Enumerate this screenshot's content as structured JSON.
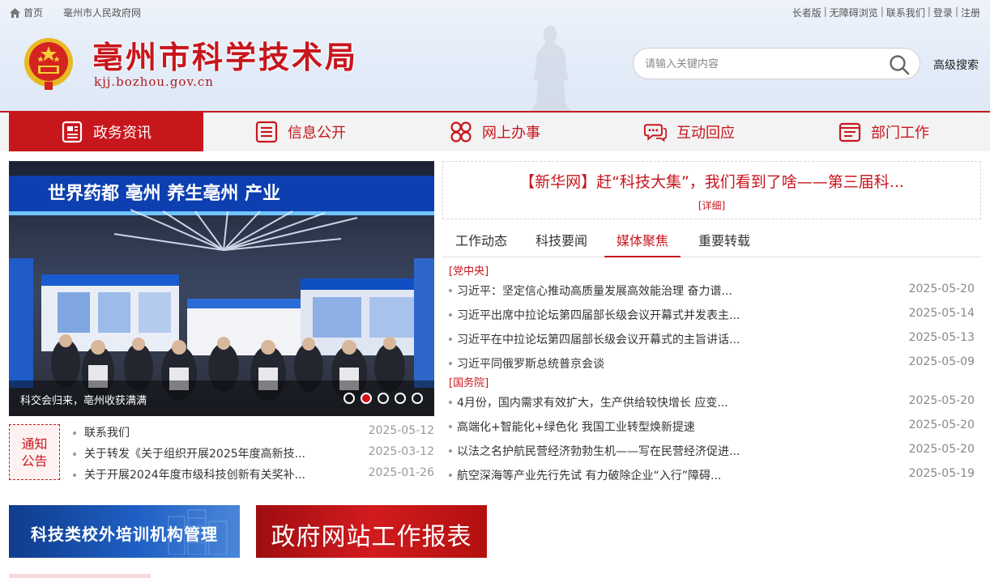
{
  "topbar": {
    "home": "首页",
    "gov_link": "毫州市人民政府网",
    "links": [
      "长者版",
      "无障碍浏览",
      "联系我们",
      "登录",
      "注册"
    ]
  },
  "header": {
    "title": "亳州市科学技术局",
    "domain": "kjj.bozhou.gov.cn",
    "search_placeholder": "请输入关键内容",
    "advanced_search": "高级搜索"
  },
  "nav": {
    "items": [
      {
        "label": "政务资讯",
        "icon": "news-doc-icon",
        "active": true
      },
      {
        "label": "信息公开",
        "icon": "list-doc-icon",
        "active": false
      },
      {
        "label": "网上办事",
        "icon": "clover-grid-icon",
        "active": false
      },
      {
        "label": "互动回应",
        "icon": "chat-bubble-icon",
        "active": false
      },
      {
        "label": "部门工作",
        "icon": "folder-doc-icon",
        "active": false
      }
    ]
  },
  "banner": {
    "caption": "科交会归来，亳州收获满满",
    "sign_text": "世界药都  亳州  养生亳州  产业",
    "slide_count": 5,
    "active_slide": 2
  },
  "headline": {
    "title": "【新华网】赶“科技大集”，我们看到了啥——第三届科...",
    "more": "[详细]"
  },
  "tabs": [
    "工作动态",
    "科技要闻",
    "媒体聚焦",
    "重要转载"
  ],
  "active_tab": 2,
  "news": {
    "groups": [
      {
        "label": "[党中央]",
        "items": [
          {
            "title": "习近平：坚定信心推动高质量发展高效能治理 奋力谱...",
            "date": "2025-05-20"
          },
          {
            "title": "习近平出席中拉论坛第四届部长级会议开幕式并发表主...",
            "date": "2025-05-14"
          },
          {
            "title": "习近平在中拉论坛第四届部长级会议开幕式的主旨讲话...",
            "date": "2025-05-13"
          },
          {
            "title": "习近平同俄罗斯总统普京会谈",
            "date": "2025-05-09"
          }
        ]
      },
      {
        "label": "[国务院]",
        "items": [
          {
            "title": "4月份，国内需求有效扩大，生产供给较快增长 应变...",
            "date": "2025-05-20"
          },
          {
            "title": "高端化+智能化+绿色化 我国工业转型焕新提速",
            "date": "2025-05-20"
          },
          {
            "title": "以法之名护航民营经济勃勃生机——写在民营经济促进...",
            "date": "2025-05-20"
          },
          {
            "title": "航空深海等产业先行先试 有力破除企业“入行”障碍...",
            "date": "2025-05-19"
          }
        ]
      }
    ]
  },
  "notice": {
    "badge_line1": "通知",
    "badge_line2": "公告",
    "items": [
      {
        "title": "联系我们",
        "date": "2025-05-12"
      },
      {
        "title": "关于转发《关于组织开展2025年度高新技...",
        "date": "2025-03-12"
      },
      {
        "title": "关于开展2024年度市级科技创新有关奖补...",
        "date": "2025-01-26"
      }
    ]
  },
  "promos": [
    {
      "text": "科技类校外培训机构管理"
    },
    {
      "text": "政府网站工作报表"
    }
  ],
  "colors": {
    "brand_red": "#c8161d",
    "nav_bg": "#f3f3f3",
    "header_bg": "#e3ecf8"
  }
}
